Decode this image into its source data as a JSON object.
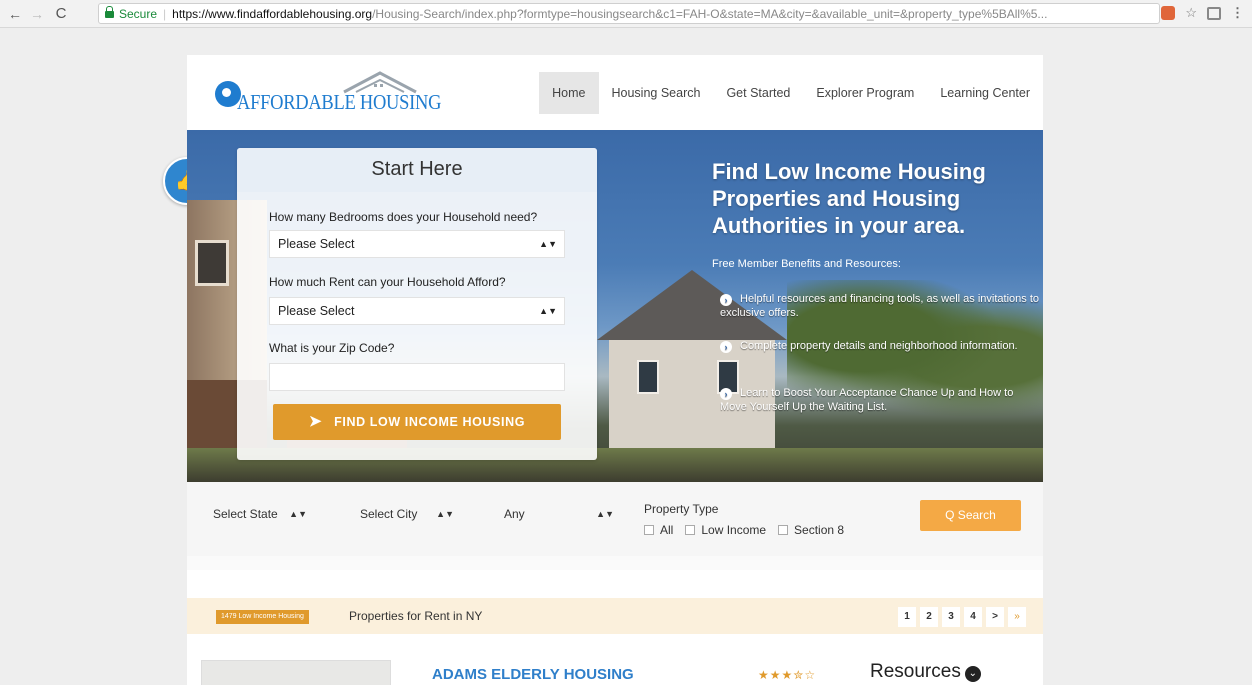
{
  "browser": {
    "secure_label": "Secure",
    "url_host": "https://www.findaffordablehousing.org",
    "url_path": "/Housing-Search/index.php?formtype=housingsearch&c1=FAH-O&state=MA&city=&available_unit=&property_type%5BAll%5..."
  },
  "header": {
    "logo_text": "AFFORDABLE HOUSING",
    "nav": [
      "Home",
      "Housing Search",
      "Get Started",
      "Explorer Program",
      "Learning Center"
    ],
    "active_nav": "Home"
  },
  "start_form": {
    "title": "Start Here",
    "bedrooms_label": "How many Bedrooms does your Household need?",
    "bedrooms_value": "Please Select",
    "rent_label": "How much Rent can your Household Afford?",
    "rent_value": "Please Select",
    "zip_label": "What is your Zip Code?",
    "zip_value": "",
    "submit_label": "FIND LOW INCOME HOUSING"
  },
  "hero": {
    "title": "Find Low Income Housing Properties and Housing Authorities in your area.",
    "subtitle": "Free Member Benefits and Resources:",
    "benefits": [
      "Helpful resources and financing tools, as well as invitations to exclusive offers.",
      "Complete property details and neighborhood information.",
      "Learn to Boost Your Acceptance Chance Up and How to Move Yourself Up the Waiting List."
    ]
  },
  "filter": {
    "state": "Select State",
    "city": "Select City",
    "any": "Any",
    "property_type_label": "Property Type",
    "types": [
      "All",
      "Low Income",
      "Section 8"
    ],
    "search_label": "Q Search"
  },
  "results": {
    "count_badge": "1479 Low Income Housing",
    "summary": "Properties for Rent in NY",
    "pages": [
      "1",
      "2",
      "3",
      "4",
      ">",
      "»"
    ],
    "listing": {
      "title": "ADAMS ELDERLY HOUSING",
      "rating_stars": 3.5,
      "rating_max": 5,
      "stars_text": "★★★✮☆"
    },
    "resources_label": "Resources"
  },
  "icons": {
    "thumb": "thumbs-up-icon",
    "plane": "paper-plane-icon",
    "benefit_bullet": "arrow-circle-icon"
  },
  "colors": {
    "brand_blue": "#1f7ccf",
    "accent_orange": "#e09a2c",
    "search_orange": "#f4a945"
  }
}
